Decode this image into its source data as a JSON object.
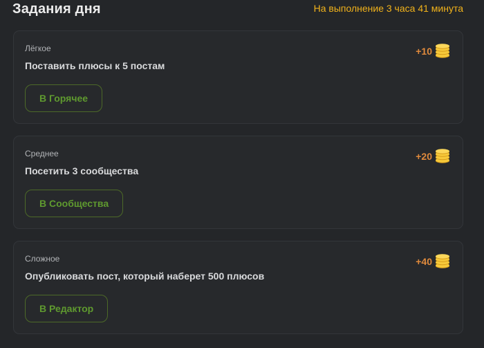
{
  "header": {
    "title": "Задания дня",
    "time_left": "На выполнение 3 часа 41 минута"
  },
  "tasks": [
    {
      "difficulty": "Лёгкое",
      "text": "Поставить плюсы к 5 постам",
      "reward": "+10",
      "button_label": "В Горячее"
    },
    {
      "difficulty": "Среднее",
      "text": "Посетить 3 сообщества",
      "reward": "+20",
      "button_label": "В Сообщества"
    },
    {
      "difficulty": "Сложное",
      "text": "Опубликовать пост, который наберет 500 плюсов",
      "reward": "+40",
      "button_label": "В Редактор"
    }
  ],
  "colors": {
    "background": "#242629",
    "card_background": "#27292c",
    "accent_time": "#f2b31b",
    "reward": "#e08a3c",
    "button_green": "#5f9a2f",
    "coin": "#f6c93a"
  },
  "icons": {
    "reward": "coin-stack-icon"
  }
}
